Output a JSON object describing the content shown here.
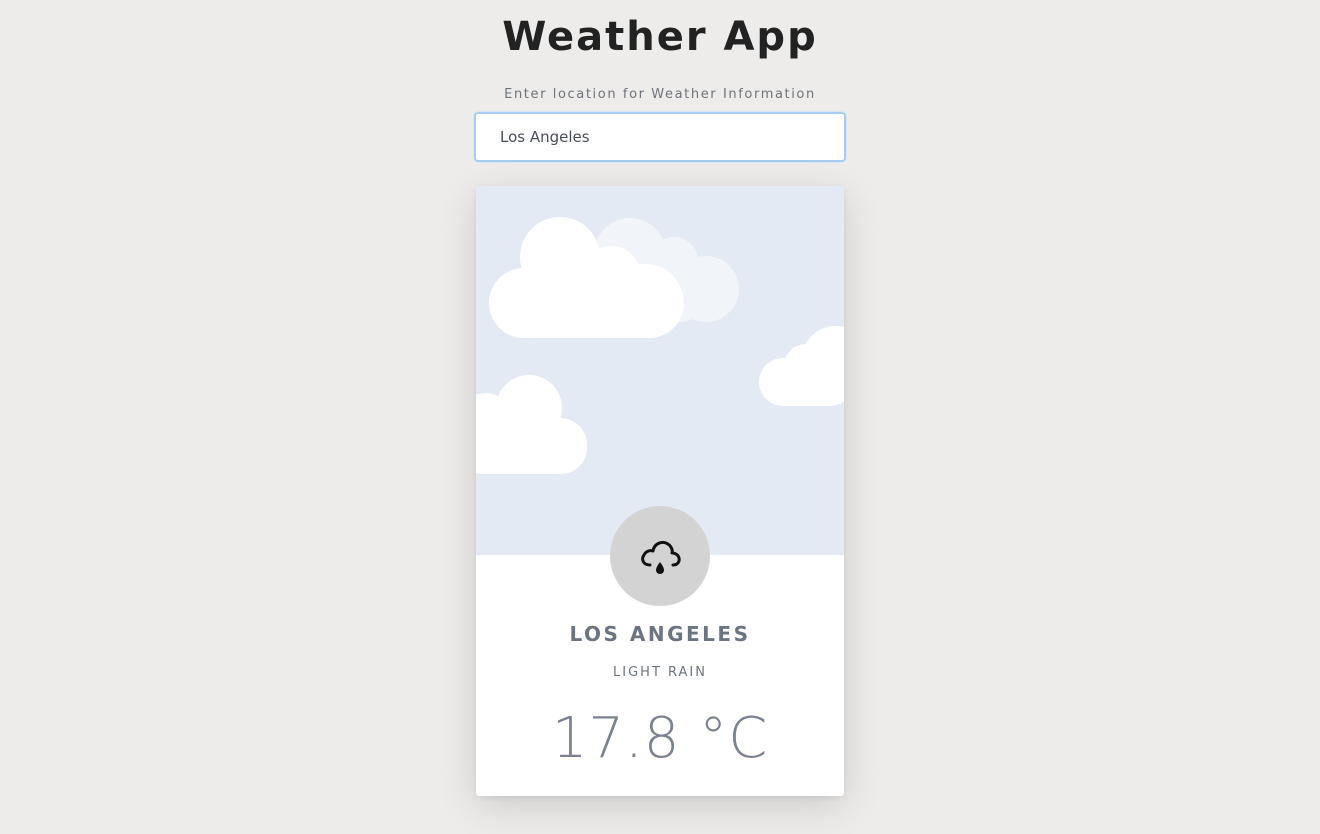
{
  "header": {
    "title": "Weather App"
  },
  "search": {
    "label": "Enter location for Weather Information",
    "value": "Los Angeles",
    "placeholder": ""
  },
  "weather": {
    "city": "LOS ANGELES",
    "condition": "LIGHT RAIN",
    "temperature": "17.8 °C",
    "icon": "cloud-rain-icon"
  },
  "colors": {
    "background": "#eeecea",
    "sky": "#e4eaf4",
    "icon_circle": "#d3d3d3",
    "text_muted": "#6c7480"
  }
}
